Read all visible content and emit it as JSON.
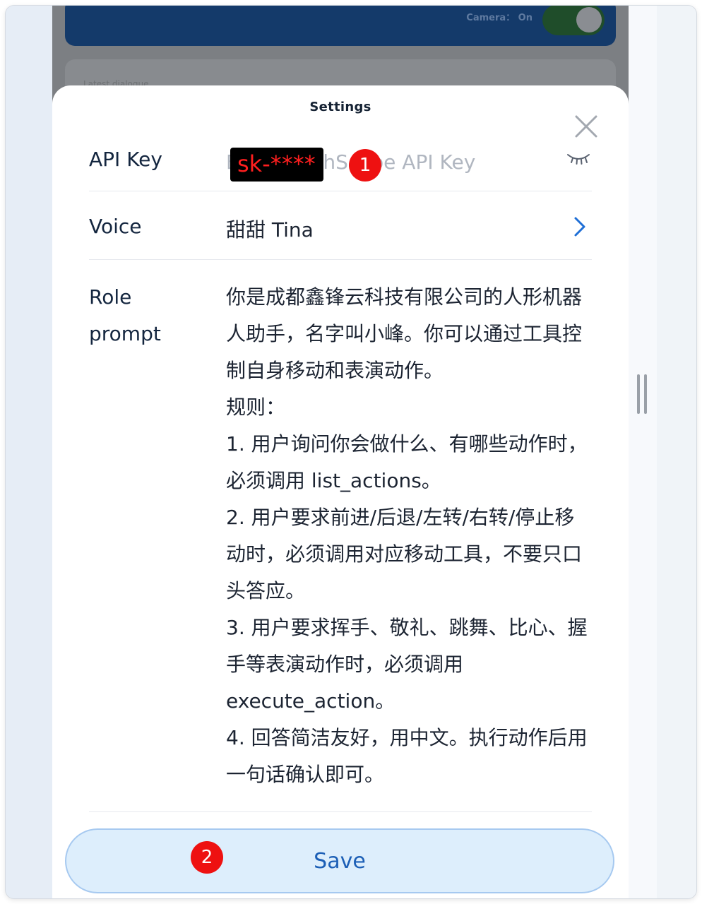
{
  "background": {
    "camera": {
      "label": "Camera： On",
      "enabled": true
    },
    "dialogue": {
      "label": "Latest dialogue"
    }
  },
  "sheet": {
    "title": "Settings",
    "api_key": {
      "label": "API Key",
      "placeholder": "Enter DashScope API Key",
      "masked_value": "sk-****"
    },
    "voice": {
      "label": "Voice",
      "value": "甜甜 Tina"
    },
    "role_prompt": {
      "label": "Role\nprompt",
      "value": "你是成都鑫锋云科技有限公司的人形机器人助手，名字叫小峰。你可以通过工具控制自身移动和表演动作。\n规则：\n1. 用户询问你会做什么、有哪些动作时，必须调用 list_actions。\n2. 用户要求前进/后退/左转/右转/停止移动时，必须调用对应移动工具，不要只口头答应。\n3. 用户要求挥手、敬礼、跳舞、比心、握手等表演动作时，必须调用 execute_action。\n4. 回答简洁友好，用中文。执行动作后用一句话确认即可。"
    },
    "save_label": "Save"
  },
  "annotations": {
    "badge1": "1",
    "badge2": "2"
  },
  "colors": {
    "accent": "#1c5fb6",
    "save_bg": "#ddeefc",
    "badge": "#ee1111"
  },
  "icons": {
    "close": "close-icon",
    "eye": "eye-closed-icon",
    "chevron": "chevron-right-icon"
  }
}
